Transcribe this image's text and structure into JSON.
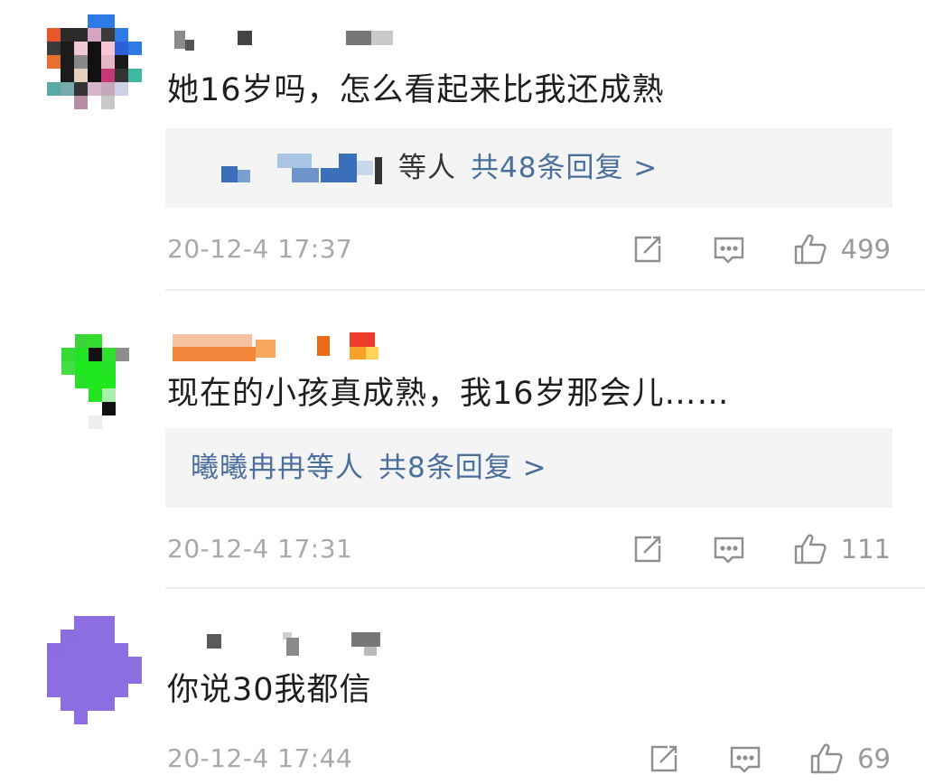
{
  "comments": [
    {
      "text": "她16岁吗，怎么看起来比我还成熟",
      "reply_users_suffix": "等人",
      "reply_count": "共48条回复 >",
      "timestamp": "20-12-4 17:37",
      "likes": "499"
    },
    {
      "text": "现在的小孩真成熟，我16岁那会儿……",
      "reply_users": "曦曦冉冉等人",
      "reply_count": "共8条回复 >",
      "timestamp": "20-12-4 17:31",
      "likes": "111"
    },
    {
      "text": "你说30我都信",
      "timestamp": "20-12-4 17:44",
      "likes": "69"
    }
  ],
  "icons": {
    "repost": "edit-share-icon",
    "comment": "comment-bubble-icon",
    "like": "thumbs-up-icon"
  },
  "colors": {
    "link": "#4a6f9c",
    "meta": "#a9a9a9",
    "reply_bg": "#f4f4f4"
  }
}
